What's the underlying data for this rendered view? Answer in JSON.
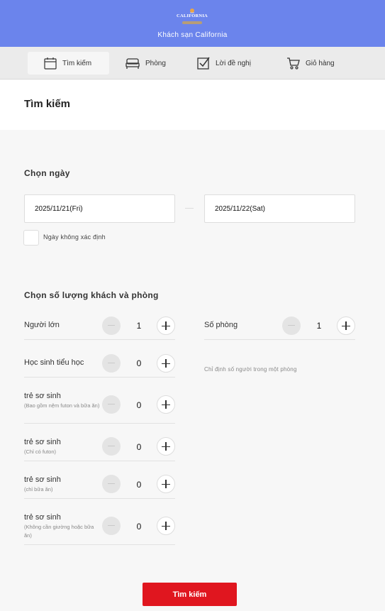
{
  "header": {
    "logo_text": "CALIFORNIA",
    "hotel_name": "Khách sạn California",
    "background": "#6b84ec"
  },
  "tabs": [
    {
      "label": "Tìm kiếm",
      "icon": "calendar-icon",
      "active": true
    },
    {
      "label": "Phòng",
      "icon": "bed-icon",
      "active": false
    },
    {
      "label": "Lời đề nghị",
      "icon": "checkbox-icon",
      "active": false
    },
    {
      "label": "Giỏ hàng",
      "icon": "cart-icon",
      "active": false
    }
  ],
  "page": {
    "title": "Tìm kiếm"
  },
  "dates": {
    "section_label": "Chọn ngày",
    "checkin": "2025/11/21(Fri)",
    "checkout": "2025/11/22(Sat)",
    "undecided_label": "Ngày không xác định"
  },
  "guests": {
    "section_label": "Chọn số lượng khách và phòng",
    "rows": [
      {
        "label": "Người lớn",
        "note": "",
        "count": "1"
      },
      {
        "label": "Học sinh tiểu học",
        "note": "",
        "count": "0"
      },
      {
        "label": "trẻ sơ sinh",
        "note": "(Bao gồm nệm futon và bữa ăn)",
        "count": "0"
      },
      {
        "label": "trẻ sơ sinh",
        "note": "(Chỉ có futon)",
        "count": "0"
      },
      {
        "label": "trẻ sơ sinh",
        "note": "(chỉ bữa ăn)",
        "count": "0"
      },
      {
        "label": "trẻ sơ sinh",
        "note": "(Không cần giường hoặc bữa ăn)",
        "count": "0"
      }
    ],
    "rooms": {
      "label": "Số phòng",
      "count": "1",
      "note": "Chỉ định số người trong một phòng"
    }
  },
  "actions": {
    "search_label": "Tìm kiếm",
    "accent": "#e0161f"
  }
}
